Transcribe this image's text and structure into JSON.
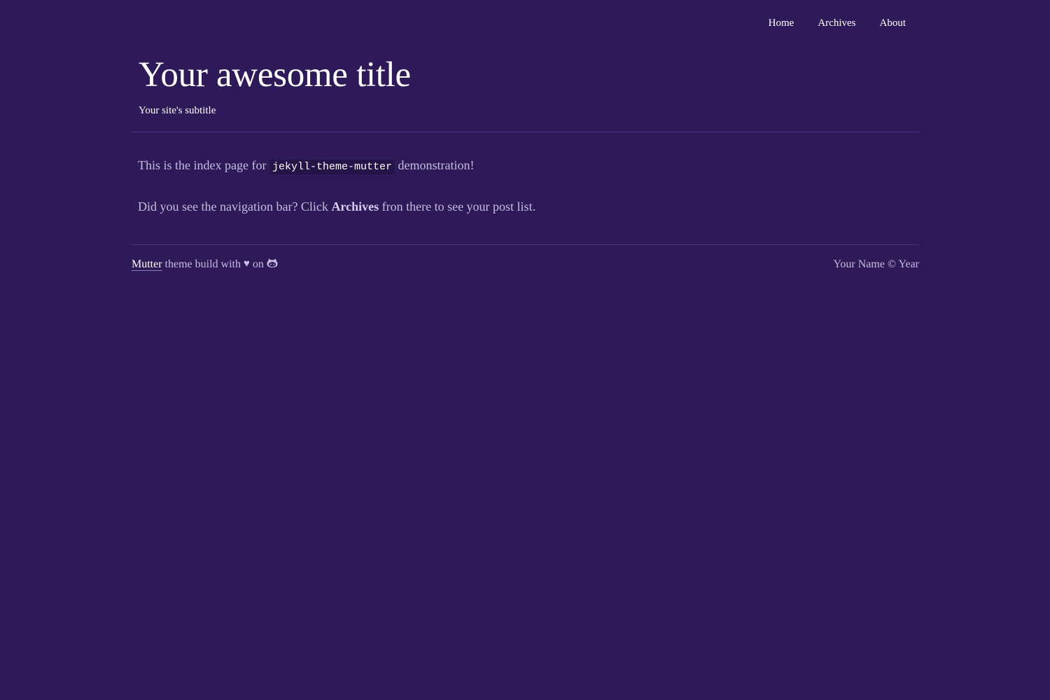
{
  "nav": {
    "items": [
      "Home",
      "Archives",
      "About"
    ]
  },
  "header": {
    "title": "Your awesome title",
    "subtitle": "Your site's subtitle"
  },
  "content": {
    "para1_prefix": "This is the index page for",
    "para1_code": "jekyll-theme-mutter",
    "para1_suffix": "demonstration!",
    "para2_prefix": "Did you see the navigation bar? Click",
    "para2_strong": "Archives",
    "para2_suffix": "fron there to see your post list."
  },
  "footer": {
    "theme_link": "Mutter",
    "build_text": "theme build with",
    "heart": "♥",
    "on_text": "on",
    "copyright": "Your Name © Year"
  },
  "colors": {
    "background": "#2e1a59",
    "text": "#c6bce0",
    "accent": "#ffffff",
    "divider": "#4b3584"
  },
  "icons": {
    "heart": "heart-icon",
    "github": "github-octocat-icon"
  }
}
